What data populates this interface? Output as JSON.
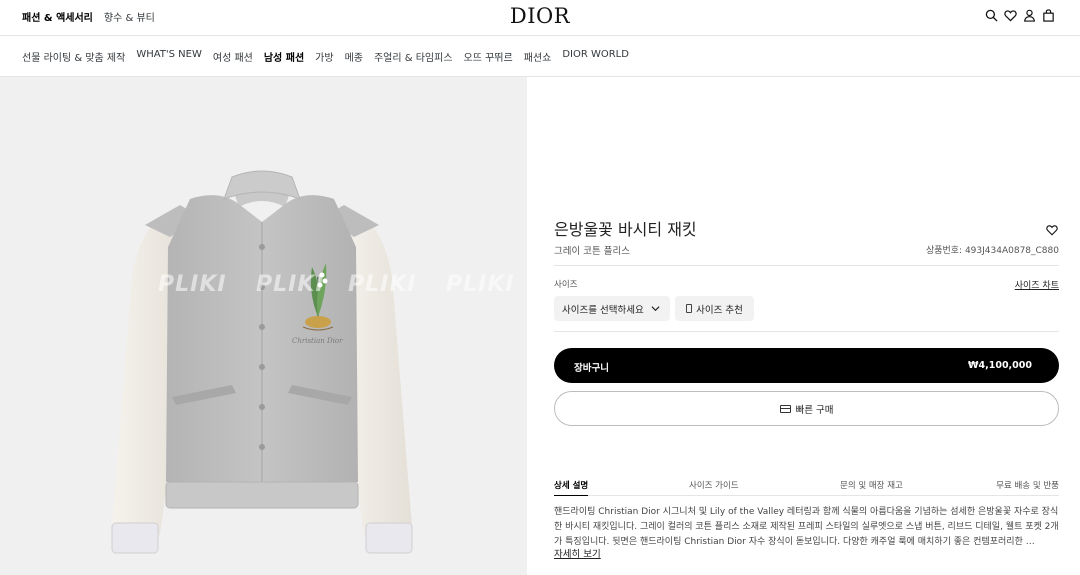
{
  "top": {
    "links": [
      "패션 & 액세서리",
      "향수 & 뷰티"
    ],
    "logo": "DIOR"
  },
  "nav": {
    "items": [
      "선물 라이팅 & 맞춤 제작",
      "WHAT'S NEW",
      "여성 패션",
      "남성 패션",
      "가방",
      "메종",
      "주얼리 & 타임피스",
      "오뜨 꾸뛰르",
      "패션쇼",
      "DIOR WORLD"
    ]
  },
  "image": {
    "watermark": "PLIKI",
    "alt_colors": {
      "body": "#bdbdbd",
      "sleeves": "#efebe4",
      "rib": "#c6c6c6"
    }
  },
  "product": {
    "title": "은방울꽃 바시티 재킷",
    "subtitle": "그레이 코튼 플리스",
    "sku": "상품번호: 493J434A0878_C880",
    "size_label": "사이즈",
    "size_chart": "사이즈 차트",
    "size_select": "사이즈를 선택하세요",
    "size_reco": "사이즈 추천",
    "cart_label": "장바구니",
    "price": "₩4,100,000",
    "quick_buy": "빠른 구매"
  },
  "tabs": [
    "상세 설명",
    "사이즈 가이드",
    "문의 및 매장 재고",
    "무료 배송 및 반품"
  ],
  "description": "핸드라이팅 Christian Dior 시그니처 및 Lily of the Valley 레터링과 함께 식물의 아름다움을 기념하는 섬세한 은방울꽃 자수로 장식한 바시티 재킷입니다. 그레이 컬러의 코튼 플리스 소재로 제작된 프레피 스타일의 실루엣으로 스냅 버튼, 리브드 디테일, 웰트 포켓 2개가 특징입니다. 뒷면은 핸드라이팅 Christian Dior 자수 장식이 돋보입니다. 다양한 캐주얼 룩에 매치하기 좋은 컨템포러리한 …",
  "more_label": "자세히 보기"
}
